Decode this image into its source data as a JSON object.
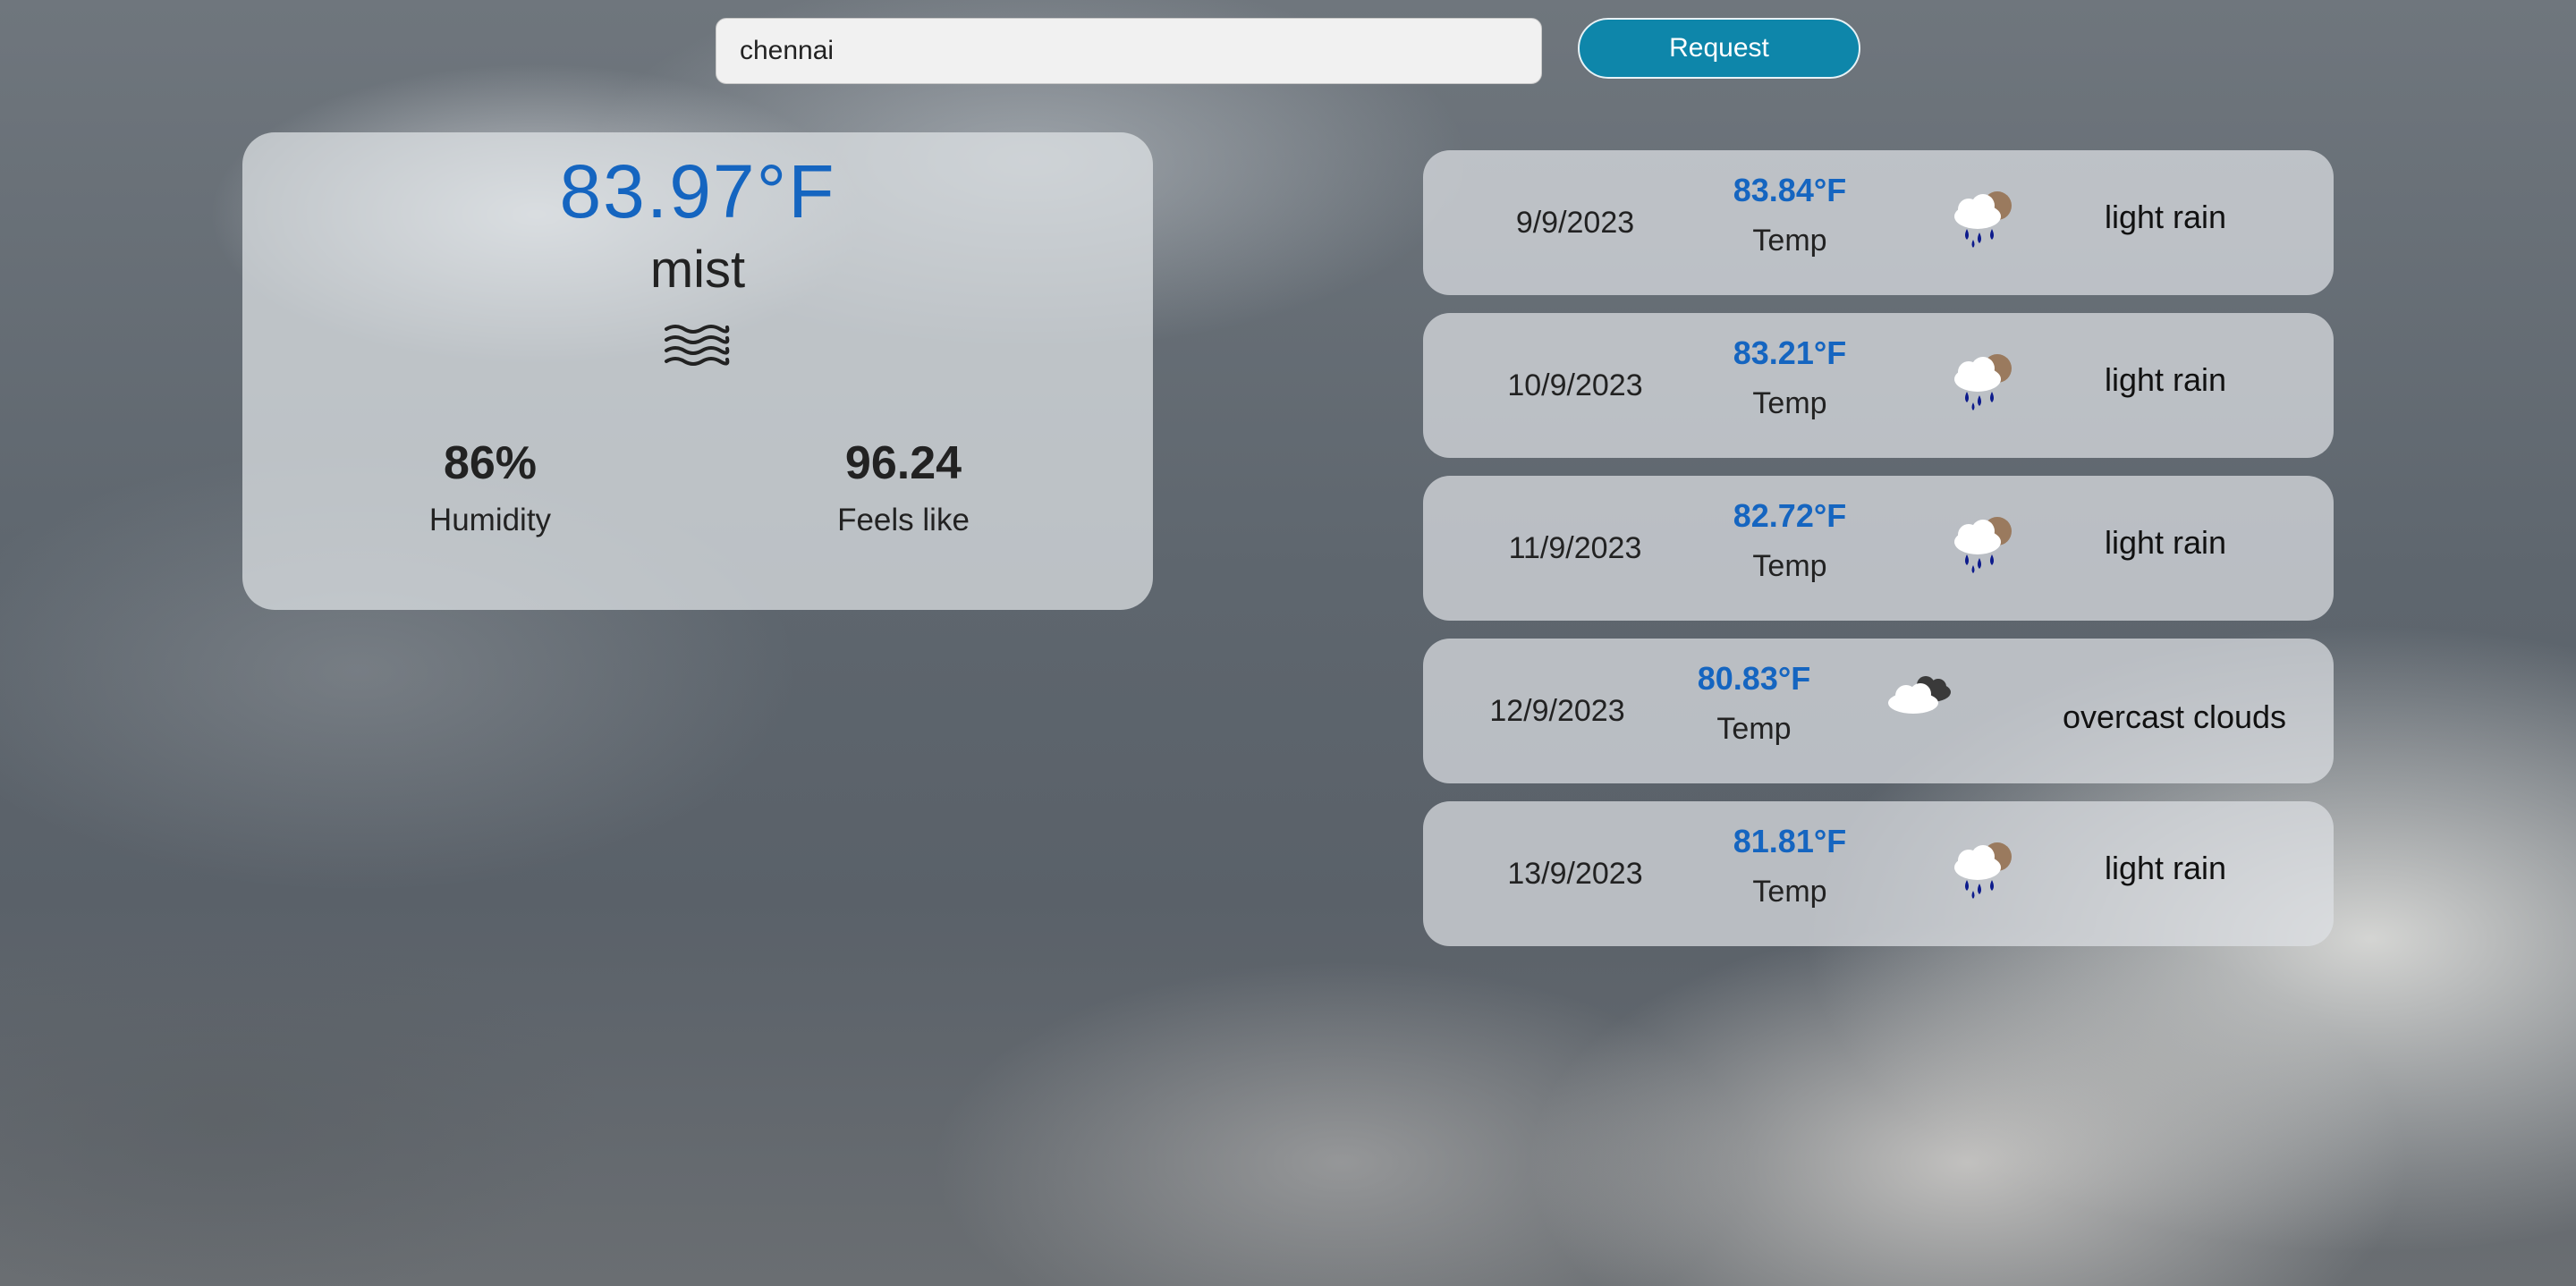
{
  "search": {
    "value": "chennai",
    "button_label": "Request"
  },
  "current": {
    "temperature": "83.97°F",
    "description": "mist",
    "icon": "mist-icon",
    "humidity_value": "86%",
    "humidity_label": "Humidity",
    "feels_like_value": "96.24",
    "feels_like_label": "Feels like"
  },
  "forecast": [
    {
      "date": "9/9/2023",
      "temp": "83.84°F",
      "temp_label": "Temp",
      "icon": "light-rain-icon",
      "description": "light rain"
    },
    {
      "date": "10/9/2023",
      "temp": "83.21°F",
      "temp_label": "Temp",
      "icon": "light-rain-icon",
      "description": "light rain"
    },
    {
      "date": "11/9/2023",
      "temp": "82.72°F",
      "temp_label": "Temp",
      "icon": "light-rain-icon",
      "description": "light rain"
    },
    {
      "date": "12/9/2023",
      "temp": "80.83°F",
      "temp_label": "Temp",
      "icon": "overcast-clouds-icon",
      "description": "overcast clouds"
    },
    {
      "date": "13/9/2023",
      "temp": "81.81°F",
      "temp_label": "Temp",
      "icon": "light-rain-icon",
      "description": "light rain"
    }
  ],
  "colors": {
    "accent_temp": "#1565c0",
    "button": "#0e86aa"
  }
}
